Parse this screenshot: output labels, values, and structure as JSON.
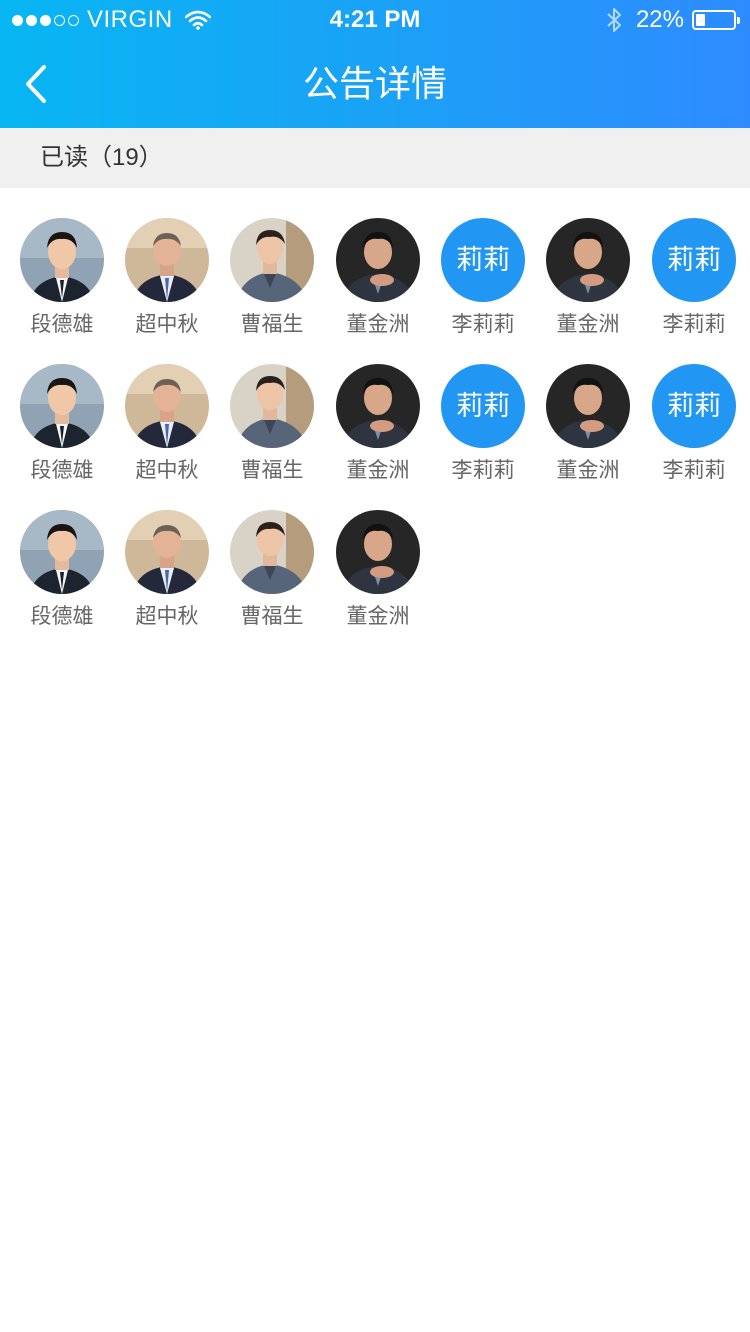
{
  "status_bar": {
    "carrier": "VIRGIN",
    "time": "4:21 PM",
    "battery": "22%"
  },
  "nav": {
    "title": "公告详情"
  },
  "section": {
    "read_label": "已读（19）"
  },
  "people": [
    {
      "name": "段德雄",
      "avatar": "photo-young-man"
    },
    {
      "name": "超中秋",
      "avatar": "photo-suited-man"
    },
    {
      "name": "曹福生",
      "avatar": "photo-casual-man"
    },
    {
      "name": "董金洲",
      "avatar": "photo-older-man"
    },
    {
      "name": "李莉莉",
      "avatar": "text",
      "avatar_text": "莉莉"
    },
    {
      "name": "董金洲",
      "avatar": "photo-older-man"
    },
    {
      "name": "李莉莉",
      "avatar": "text",
      "avatar_text": "莉莉"
    },
    {
      "name": "段德雄",
      "avatar": "photo-young-man"
    },
    {
      "name": "超中秋",
      "avatar": "photo-suited-man"
    },
    {
      "name": "曹福生",
      "avatar": "photo-casual-man"
    },
    {
      "name": "董金洲",
      "avatar": "photo-older-man"
    },
    {
      "name": "李莉莉",
      "avatar": "text",
      "avatar_text": "莉莉"
    },
    {
      "name": "董金洲",
      "avatar": "photo-older-man"
    },
    {
      "name": "李莉莉",
      "avatar": "text",
      "avatar_text": "莉莉"
    },
    {
      "name": "段德雄",
      "avatar": "photo-young-man"
    },
    {
      "name": "超中秋",
      "avatar": "photo-suited-man"
    },
    {
      "name": "曹福生",
      "avatar": "photo-casual-man"
    },
    {
      "name": "董金洲",
      "avatar": "photo-older-man"
    }
  ],
  "colors": {
    "header_start": "#08b6f3",
    "header_end": "#2e8bff",
    "text_avatar_bg": "#2196f3",
    "section_bg": "#f0f0f0"
  }
}
